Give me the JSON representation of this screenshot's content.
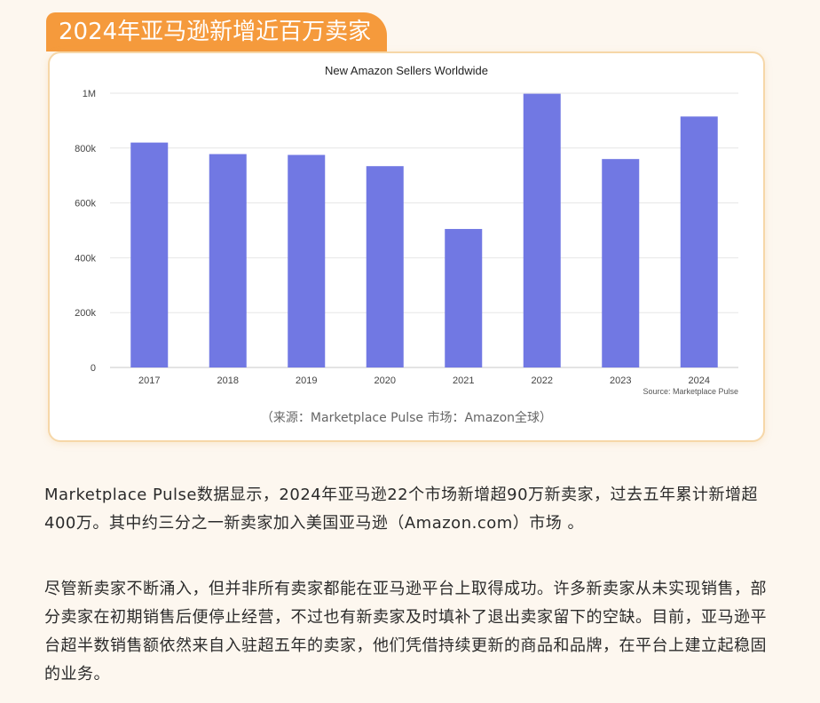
{
  "section_title": "2024年亚马逊新增近百万卖家",
  "chart_data": {
    "type": "bar",
    "title": "New Amazon Sellers Worldwide",
    "categories": [
      "2017",
      "2018",
      "2019",
      "2020",
      "2021",
      "2022",
      "2023",
      "2024"
    ],
    "values": [
      820000,
      778000,
      775000,
      734000,
      505000,
      998000,
      760000,
      915000
    ],
    "ylim": [
      0,
      1000000
    ],
    "yticks": [
      0,
      200000,
      400000,
      600000,
      800000,
      1000000
    ],
    "ytick_labels": [
      "0",
      "200k",
      "400k",
      "600k",
      "800k",
      "1M"
    ],
    "grid": true,
    "bar_color": "#7178e3",
    "chart_source": "Source: Marketplace Pulse"
  },
  "caption": "（来源：Marketplace Pulse    市场：Amazon全球）",
  "paragraphs": [
    "Marketplace Pulse数据显示，2024年亚马逊22个市场新增超90万新卖家，过去五年累计新增超400万。其中约三分之一新卖家加入美国亚马逊（Amazon.com）市场 。",
    "尽管新卖家不断涌入，但并非所有卖家都能在亚马逊平台上取得成功。许多新卖家从未实现销售，部分卖家在初期销售后便停止经营，不过也有新卖家及时填补了退出卖家留下的空缺。目前，亚马逊平台超半数销售额依然来自入驻超五年的卖家，他们凭借持续更新的商品和品牌，在平台上建立起稳固的业务。"
  ]
}
